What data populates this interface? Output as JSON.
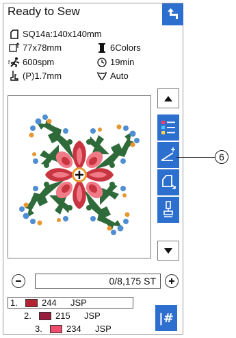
{
  "header": {
    "title": "Ready to Sew"
  },
  "info": {
    "hoop": "SQ14a:140x140mm",
    "size": "77x78mm",
    "colors": "6Colors",
    "speed": "600spm",
    "time": "19min",
    "presser": "(P)1.7mm",
    "thread_cut": "Auto"
  },
  "stitch": {
    "counter": "0/8,175 ST"
  },
  "color_list": [
    {
      "num": "1.",
      "color": "#b4232f",
      "code": "244",
      "brand": "JSP"
    },
    {
      "num": "2.",
      "color": "#9a1c3c",
      "code": "215",
      "brand": "JSP"
    },
    {
      "num": "3.",
      "color": "#f04d6e",
      "code": "234",
      "brand": "JSP"
    }
  ],
  "callout": {
    "label": "6"
  },
  "colors": {
    "accent_blue": "#2d6fcf",
    "design_green": "#2f6b3a",
    "design_red": "#c8343f",
    "design_pink": "#f07a86",
    "design_blue": "#4f8ed3",
    "design_orange": "#e8962e"
  }
}
